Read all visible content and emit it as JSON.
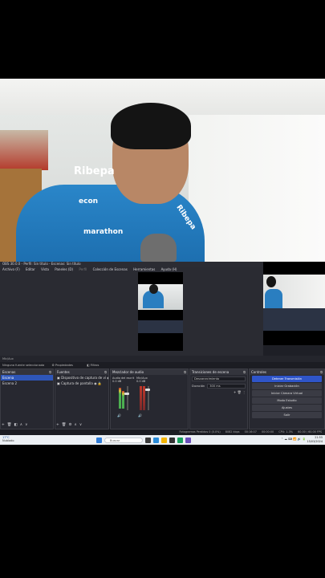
{
  "window": {
    "title": "OBS 30.0.0 - Perfil: Sin título - Escenas: Sin título"
  },
  "menu": [
    "Archivo (F)",
    "Editar",
    "Vista",
    "Paneles (D)",
    "Perfil",
    "Colección de Escenas",
    "Herramientas",
    "Ayuda (H)"
  ],
  "preview_bar": {
    "source": "Mic/Aux",
    "source_status": "Ninguna fuente seleccionada",
    "properties_label": "Propiedades",
    "filters_label": "Filtros"
  },
  "docks": {
    "scenes": {
      "title": "Escenas",
      "items": [
        "Escena",
        "Escena 2"
      ],
      "selected": 0
    },
    "sources": {
      "title": "Fuentes",
      "items": [
        "Dispositivo de captura de vi",
        "Captura de pantalla"
      ]
    },
    "mixer": {
      "title": "Mezclador de audio",
      "channels": [
        {
          "name": "Audio del escrit",
          "db": "0.0 dB",
          "level": 0.6
        },
        {
          "name": "Mic/Aux",
          "db": "0.0 dB",
          "level": 0.75
        }
      ]
    },
    "transitions": {
      "title": "Transiciones de escena",
      "selected": "Desvanecimiento",
      "duration_label": "Duración",
      "duration_value": "300 ms"
    },
    "controls": {
      "title": "Controles",
      "buttons": [
        "Detener Transmisión",
        "Iniciar Grabación",
        "Iniciar Cámara Virtual",
        "Modo Estudio",
        "Ajustes",
        "Salir"
      ]
    }
  },
  "status_bar": {
    "frames": "Fotogramas Perdidos 0 (0.0%)",
    "bitrate": "8082 kbps",
    "live_time": "00:16:07",
    "rec_time": "00:00:00",
    "cpu": "CPU: 1.3%",
    "fps": "60.00 / 60.00 FPS"
  },
  "taskbar": {
    "weather_temp": "17°C",
    "weather_desc": "Nublado",
    "search_placeholder": "Buscar",
    "time": "21:55",
    "date": "15/03/2024"
  },
  "overlay_brand": {
    "shirt_left": "Ribepa",
    "shirt_mid": "econ",
    "shirt_low": "marathon",
    "shirt_right": "Ribepa"
  }
}
